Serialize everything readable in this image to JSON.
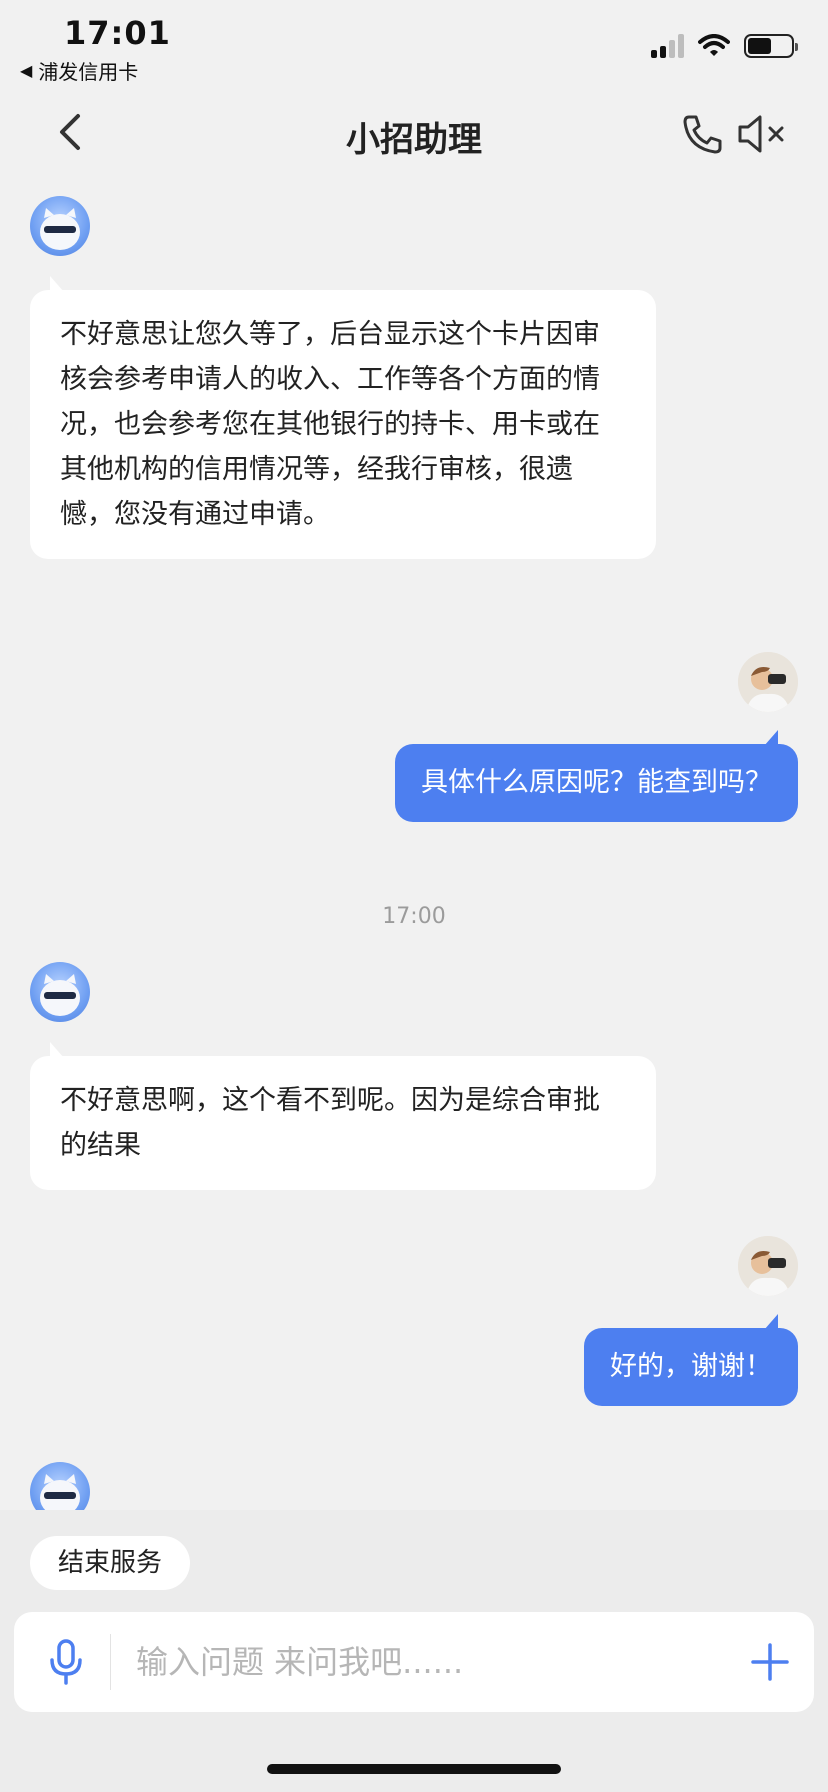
{
  "status_bar": {
    "time": "17:01",
    "back_app_label": "浦发信用卡"
  },
  "header": {
    "title": "小招助理"
  },
  "messages": [
    {
      "from": "bot",
      "text": "不好意思让您久等了，后台显示这个卡片因审核会参考申请人的收入、工作等各个方面的情况，也会参考您在其他银行的持卡、用卡或在其他机构的信用情况等，经我行审核，很遗憾，您没有通过申请。"
    },
    {
      "from": "user",
      "text": "具体什么原因呢？能查到吗？"
    },
    {
      "from": "bot",
      "text": "不好意思啊，这个看不到呢。因为是综合审批的结果"
    },
    {
      "from": "user",
      "text": "好的，谢谢！"
    }
  ],
  "time_separator": "17:00",
  "quick_reply": {
    "end_service_label": "结束服务"
  },
  "input": {
    "placeholder": "输入问题 来问我吧......"
  },
  "colors": {
    "accent": "#4d7ff0",
    "background": "#f1f1f1",
    "bot_bubble": "#ffffff"
  },
  "icons": [
    "back-chevron-icon",
    "phone-icon",
    "speaker-mute-icon",
    "microphone-icon",
    "plus-icon",
    "signal-icon",
    "wifi-icon",
    "battery-icon"
  ]
}
